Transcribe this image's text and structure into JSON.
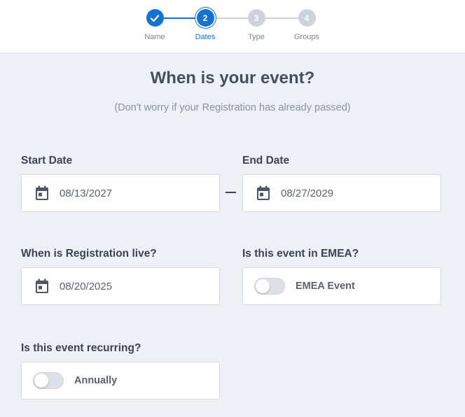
{
  "stepper": {
    "steps": [
      {
        "number": "",
        "label": "Name",
        "state": "done"
      },
      {
        "number": "2",
        "label": "Dates",
        "state": "current"
      },
      {
        "number": "3",
        "label": "Type",
        "state": "pending"
      },
      {
        "number": "4",
        "label": "Groups",
        "state": "pending"
      }
    ],
    "accent_color": "#1572d3",
    "pending_color": "#cdd3da"
  },
  "heading": {
    "title": "When is your event?",
    "subtitle": "(Don't worry if your Registration has already passed)"
  },
  "fields": {
    "start_date": {
      "label": "Start Date",
      "value": "08/13/2027",
      "icon": "calendar-icon"
    },
    "end_date": {
      "label": "End Date",
      "value": "08/27/2029",
      "icon": "calendar-icon"
    },
    "registration_live": {
      "label": "When is Registration live?",
      "value": "08/20/2025",
      "icon": "calendar-icon"
    },
    "emea": {
      "label": "Is this event in EMEA?",
      "toggle_label": "EMEA Event",
      "enabled": false
    },
    "recurring": {
      "label": "Is this event recurring?",
      "toggle_label": "Annually",
      "enabled": false
    }
  }
}
